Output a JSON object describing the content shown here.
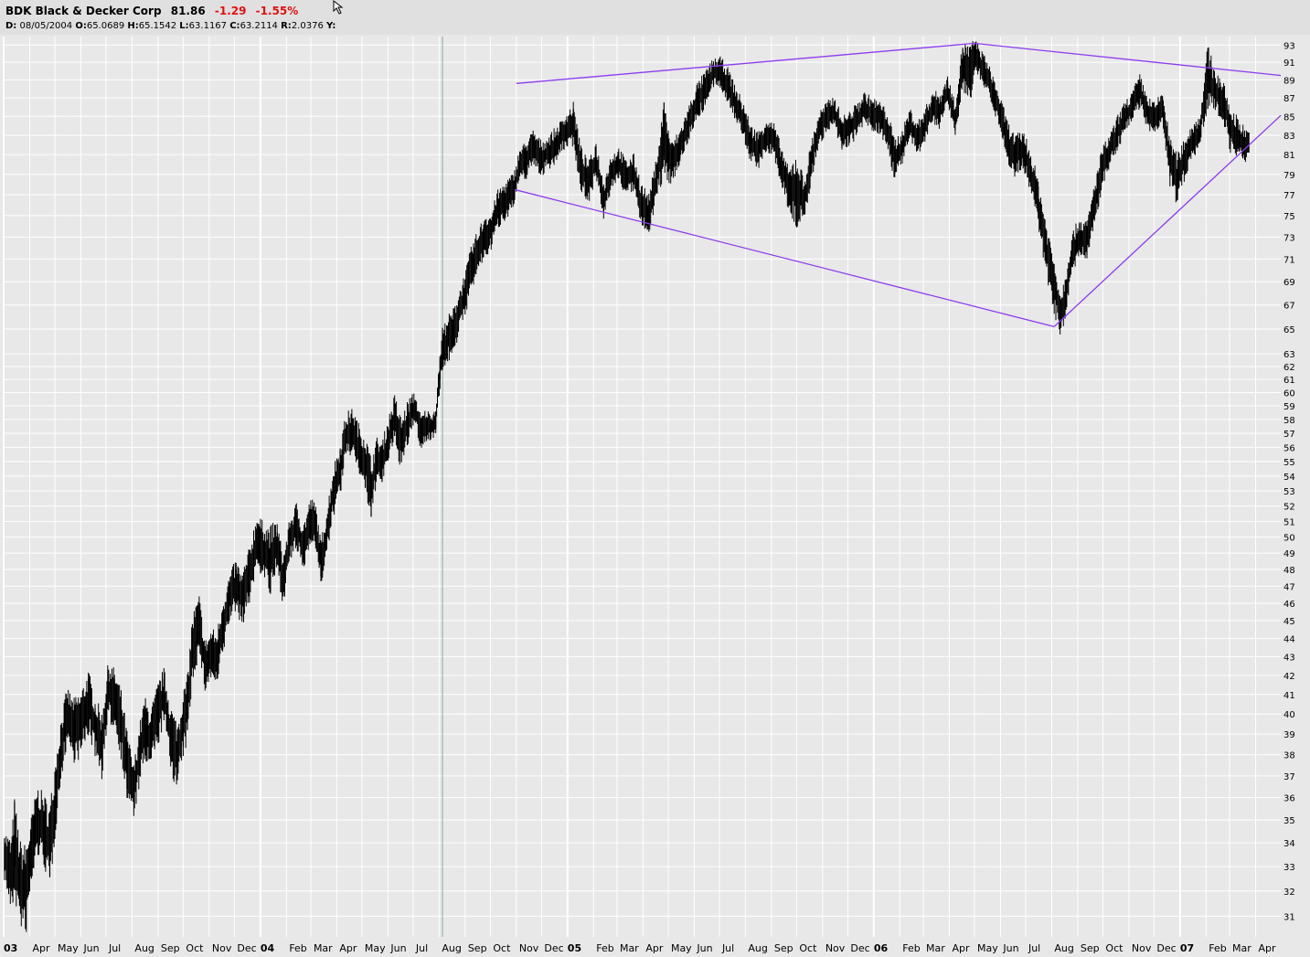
{
  "header": {
    "symbol": "BDK",
    "name": "Black & Decker Corp",
    "last": "81.86",
    "change": "-1.29",
    "change_pct": "-1.55%",
    "ohlc": {
      "date_label": "D:",
      "date": "08/05/2004",
      "open_label": "O:",
      "open": "65.0689",
      "high_label": "H:",
      "high": "65.1542",
      "low_label": "L:",
      "low": "63.1167",
      "close_label": "C:",
      "close": "63.2114",
      "range_label": "R:",
      "range": "2.0376",
      "y_label": "Y:"
    }
  },
  "colors": {
    "background": "#e8e8e8",
    "grid": "#ffffff",
    "price": "#000000",
    "trendline": "#8c3cf0",
    "crosshair": "#88aaaa",
    "negative": "#e01010"
  },
  "chart_data": {
    "type": "line",
    "style": "ohlc-bars",
    "scale": "log",
    "grid": true,
    "xlim": [
      "2003-03-01",
      "2007-05-01"
    ],
    "ylim": [
      30.2,
      94
    ],
    "x_ticks": [
      {
        "date": "2003-03-01",
        "label": "03",
        "bold": true
      },
      {
        "date": "2003-04-01",
        "label": "Apr"
      },
      {
        "date": "2003-05-01",
        "label": "May"
      },
      {
        "date": "2003-06-01",
        "label": "Jun"
      },
      {
        "date": "2003-07-01",
        "label": "Jul"
      },
      {
        "date": "2003-08-01",
        "label": "Aug"
      },
      {
        "date": "2003-09-01",
        "label": "Sep"
      },
      {
        "date": "2003-10-01",
        "label": "Oct"
      },
      {
        "date": "2003-11-01",
        "label": "Nov"
      },
      {
        "date": "2003-12-01",
        "label": "Dec"
      },
      {
        "date": "2004-01-01",
        "label": "04",
        "bold": true
      },
      {
        "date": "2004-02-01",
        "label": "Feb"
      },
      {
        "date": "2004-03-01",
        "label": "Mar"
      },
      {
        "date": "2004-04-01",
        "label": "Apr"
      },
      {
        "date": "2004-05-01",
        "label": "May"
      },
      {
        "date": "2004-06-01",
        "label": "Jun"
      },
      {
        "date": "2004-07-01",
        "label": "Jul"
      },
      {
        "date": "2004-08-01",
        "label": "Aug"
      },
      {
        "date": "2004-09-01",
        "label": "Sep"
      },
      {
        "date": "2004-10-01",
        "label": "Oct"
      },
      {
        "date": "2004-11-01",
        "label": "Nov"
      },
      {
        "date": "2004-12-01",
        "label": "Dec"
      },
      {
        "date": "2005-01-01",
        "label": "05",
        "bold": true
      },
      {
        "date": "2005-02-01",
        "label": "Feb"
      },
      {
        "date": "2005-03-01",
        "label": "Mar"
      },
      {
        "date": "2005-04-01",
        "label": "Apr"
      },
      {
        "date": "2005-05-01",
        "label": "May"
      },
      {
        "date": "2005-06-01",
        "label": "Jun"
      },
      {
        "date": "2005-07-01",
        "label": "Jul"
      },
      {
        "date": "2005-08-01",
        "label": "Aug"
      },
      {
        "date": "2005-09-01",
        "label": "Sep"
      },
      {
        "date": "2005-10-01",
        "label": "Oct"
      },
      {
        "date": "2005-11-01",
        "label": "Nov"
      },
      {
        "date": "2005-12-01",
        "label": "Dec"
      },
      {
        "date": "2006-01-01",
        "label": "06",
        "bold": true
      },
      {
        "date": "2006-02-01",
        "label": "Feb"
      },
      {
        "date": "2006-03-01",
        "label": "Mar"
      },
      {
        "date": "2006-04-01",
        "label": "Apr"
      },
      {
        "date": "2006-05-01",
        "label": "May"
      },
      {
        "date": "2006-06-01",
        "label": "Jun"
      },
      {
        "date": "2006-07-01",
        "label": "Jul"
      },
      {
        "date": "2006-08-01",
        "label": "Aug"
      },
      {
        "date": "2006-09-01",
        "label": "Sep"
      },
      {
        "date": "2006-10-01",
        "label": "Oct"
      },
      {
        "date": "2006-11-01",
        "label": "Nov"
      },
      {
        "date": "2006-12-01",
        "label": "Dec"
      },
      {
        "date": "2007-01-01",
        "label": "07",
        "bold": true
      },
      {
        "date": "2007-02-01",
        "label": "Feb"
      },
      {
        "date": "2007-03-01",
        "label": "Mar"
      },
      {
        "date": "2007-04-01",
        "label": "Apr"
      }
    ],
    "y_ticks": [
      31,
      32,
      33,
      34,
      35,
      36,
      37,
      38,
      39,
      40,
      41,
      42,
      43,
      44,
      45,
      46,
      47,
      48,
      49,
      50,
      51,
      52,
      53,
      54,
      55,
      56,
      57,
      58,
      59,
      60,
      61,
      62,
      63,
      65,
      67,
      69,
      71,
      73,
      75,
      77,
      79,
      81,
      83,
      85,
      87,
      89,
      91,
      93
    ],
    "series": [
      {
        "style": "ohlc",
        "x": [
          "2003-03-02",
          "2003-03-10",
          "2003-03-14",
          "2003-03-20",
          "2003-03-27",
          "2003-04-03",
          "2003-04-10",
          "2003-04-18",
          "2003-04-25",
          "2003-05-02",
          "2003-05-09",
          "2003-05-16",
          "2003-05-23",
          "2003-06-01",
          "2003-06-10",
          "2003-06-18",
          "2003-06-26",
          "2003-07-04",
          "2003-07-11",
          "2003-07-18",
          "2003-07-26",
          "2003-08-03",
          "2003-08-10",
          "2003-08-16",
          "2003-08-23",
          "2003-09-01",
          "2003-09-08",
          "2003-09-16",
          "2003-09-24",
          "2003-10-01",
          "2003-10-06",
          "2003-10-12",
          "2003-10-20",
          "2003-10-27",
          "2003-11-04",
          "2003-11-10",
          "2003-11-17",
          "2003-11-25",
          "2003-12-03",
          "2003-12-10",
          "2003-12-18",
          "2003-12-28",
          "2004-01-06",
          "2004-01-13",
          "2004-01-21",
          "2004-01-28",
          "2004-02-05",
          "2004-02-13",
          "2004-02-21",
          "2004-03-01",
          "2004-03-07",
          "2004-03-13",
          "2004-03-20",
          "2004-03-28",
          "2004-04-05",
          "2004-04-12",
          "2004-04-20",
          "2004-04-28",
          "2004-05-05",
          "2004-05-12",
          "2004-05-19",
          "2004-05-25",
          "2004-06-01",
          "2004-06-09",
          "2004-06-17",
          "2004-06-25",
          "2004-07-03",
          "2004-07-10",
          "2004-07-17",
          "2004-07-22",
          "2004-07-28",
          "2004-08-02",
          "2004-08-05",
          "2004-08-10",
          "2004-08-17",
          "2004-08-24",
          "2004-09-01",
          "2004-09-09",
          "2004-09-17",
          "2004-09-25",
          "2004-10-02",
          "2004-10-09",
          "2004-10-16",
          "2004-10-22",
          "2004-10-29",
          "2004-11-05",
          "2004-11-13",
          "2004-11-21",
          "2004-12-01",
          "2004-12-10",
          "2004-12-20",
          "2004-12-30",
          "2005-01-08",
          "2005-01-17",
          "2005-01-26",
          "2005-02-04",
          "2005-02-13",
          "2005-02-22",
          "2005-03-03",
          "2005-03-12",
          "2005-03-21",
          "2005-03-30",
          "2005-04-08",
          "2005-04-17",
          "2005-04-26",
          "2005-05-05",
          "2005-05-15",
          "2005-05-25",
          "2005-06-04",
          "2005-06-14",
          "2005-06-24",
          "2005-07-03",
          "2005-07-12",
          "2005-07-21",
          "2005-07-30",
          "2005-08-08",
          "2005-08-17",
          "2005-08-26",
          "2005-09-04",
          "2005-09-13",
          "2005-09-22",
          "2005-10-01",
          "2005-10-10",
          "2005-10-19",
          "2005-10-28",
          "2005-11-06",
          "2005-11-15",
          "2005-11-24",
          "2005-12-03",
          "2005-12-12",
          "2005-12-21",
          "2005-12-30",
          "2006-01-08",
          "2006-01-17",
          "2006-01-26",
          "2006-02-04",
          "2006-02-13",
          "2006-02-22",
          "2006-03-03",
          "2006-03-12",
          "2006-03-21",
          "2006-03-30",
          "2006-04-08",
          "2006-04-17",
          "2006-04-26",
          "2006-05-02",
          "2006-05-06",
          "2006-05-14",
          "2006-05-23",
          "2006-06-01",
          "2006-06-10",
          "2006-06-19",
          "2006-06-28",
          "2006-07-07",
          "2006-07-16",
          "2006-07-25",
          "2006-08-03",
          "2006-08-12",
          "2006-08-18",
          "2006-08-25",
          "2006-09-03",
          "2006-09-12",
          "2006-09-21",
          "2006-09-30",
          "2006-10-09",
          "2006-10-18",
          "2006-10-27",
          "2006-11-05",
          "2006-11-14",
          "2006-11-23",
          "2006-12-02",
          "2006-12-11",
          "2006-12-20",
          "2006-12-29",
          "2007-01-07",
          "2007-01-16",
          "2007-01-25",
          "2007-02-03",
          "2007-02-12",
          "2007-02-21",
          "2007-03-02",
          "2007-03-10",
          "2007-03-17",
          "2007-03-24"
        ],
        "close": [
          33.5,
          32.6,
          33.8,
          32.4,
          32.0,
          33.6,
          35.0,
          34.6,
          33.8,
          36.2,
          38.5,
          40.0,
          39.2,
          39.5,
          40.6,
          39.4,
          38.5,
          41.2,
          40.8,
          39.8,
          37.5,
          36.3,
          38.0,
          39.2,
          38.8,
          40.0,
          41.0,
          38.9,
          37.9,
          39.5,
          40.3,
          43.5,
          44.8,
          42.5,
          43.2,
          42.8,
          44.6,
          46.3,
          47.1,
          46.2,
          47.5,
          49.8,
          49.1,
          48.5,
          49.5,
          47.3,
          49.8,
          50.7,
          49.3,
          51.2,
          50.6,
          48.4,
          50.2,
          53.0,
          54.5,
          56.8,
          57.2,
          55.8,
          55.0,
          53.0,
          55.3,
          54.8,
          56.5,
          58.0,
          56.2,
          57.8,
          59.0,
          57.0,
          57.6,
          57.4,
          58.0,
          61.7,
          63.2,
          64.0,
          64.8,
          66.2,
          68.0,
          70.3,
          71.8,
          73.2,
          73.5,
          75.5,
          76.2,
          76.8,
          77.5,
          80.0,
          80.5,
          81.8,
          80.6,
          81.3,
          82.2,
          83.5,
          84.2,
          79.6,
          78.2,
          80.5,
          76.3,
          79.3,
          80.1,
          78.6,
          79.2,
          76.0,
          75.2,
          78.6,
          82.5,
          80.2,
          81.8,
          84.2,
          86.6,
          87.9,
          89.8,
          89.7,
          88.3,
          86.2,
          84.5,
          82.0,
          81.6,
          83.0,
          82.5,
          79.8,
          77.4,
          77.6,
          76.4,
          80.5,
          83.8,
          84.9,
          85.5,
          83.0,
          83.8,
          84.5,
          86.0,
          85.2,
          84.9,
          83.6,
          80.5,
          81.8,
          84.2,
          82.6,
          84.0,
          86.1,
          85.6,
          87.9,
          84.6,
          90.7,
          89.4,
          92.2,
          91.2,
          89.8,
          87.8,
          85.1,
          82.2,
          80.8,
          81.6,
          79.2,
          76.2,
          72.2,
          69.0,
          66.2,
          68.0,
          71.5,
          73.0,
          72.6,
          76.0,
          79.6,
          81.3,
          83.2,
          84.8,
          86.0,
          87.8,
          85.4,
          84.6,
          86.1,
          80.2,
          78.5,
          80.8,
          82.4,
          83.6,
          89.5,
          87.6,
          86.8,
          83.6,
          83.0,
          82.0,
          81.86
        ],
        "high": [
          34.2,
          34.0,
          35.8,
          33.6,
          33.0,
          34.5,
          36.0,
          35.4,
          35.0,
          37.4,
          39.4,
          40.8,
          40.2,
          40.6,
          41.8,
          40.3,
          39.6,
          42.3,
          41.8,
          40.8,
          38.6,
          37.4,
          38.9,
          40.4,
          39.6,
          41.0,
          41.8,
          39.9,
          39.0,
          40.6,
          41.4,
          44.8,
          45.8,
          43.4,
          44.0,
          43.8,
          45.6,
          47.0,
          48.0,
          47.2,
          48.6,
          50.9,
          50.2,
          49.6,
          50.3,
          48.4,
          50.6,
          51.6,
          50.4,
          52.0,
          51.5,
          49.4,
          51.2,
          54.0,
          55.8,
          57.8,
          58.1,
          56.9,
          55.8,
          54.2,
          56.2,
          55.7,
          57.4,
          59.2,
          57.4,
          58.8,
          59.3,
          58.0,
          58.2,
          58.0,
          58.6,
          62.8,
          65.1,
          65.3,
          65.8,
          67.4,
          69.2,
          71.6,
          72.9,
          74.6,
          74.5,
          76.6,
          77.4,
          78.0,
          78.4,
          81.0,
          81.8,
          82.9,
          81.8,
          82.4,
          83.4,
          84.6,
          85.8,
          81.3,
          79.8,
          81.8,
          78.0,
          80.2,
          81.2,
          79.8,
          80.4,
          77.8,
          76.5,
          80.0,
          86.5,
          81.6,
          83.0,
          85.3,
          87.9,
          89.2,
          90.6,
          90.9,
          89.5,
          87.4,
          85.8,
          83.4,
          82.8,
          84.2,
          83.6,
          81.2,
          78.8,
          78.8,
          77.8,
          81.9,
          84.9,
          86.0,
          86.6,
          84.3,
          84.9,
          85.8,
          87.0,
          86.4,
          86.0,
          84.9,
          81.9,
          82.9,
          85.3,
          83.8,
          85.2,
          87.2,
          86.9,
          88.8,
          85.8,
          92.5,
          92.8,
          93.2,
          92.3,
          91.0,
          88.9,
          86.4,
          83.6,
          82.2,
          82.9,
          80.6,
          77.8,
          73.8,
          70.6,
          67.5,
          69.2,
          72.7,
          74.2,
          73.8,
          77.4,
          81.0,
          82.4,
          84.2,
          85.9,
          87.1,
          89.0,
          86.6,
          85.8,
          87.2,
          82.0,
          79.8,
          82.2,
          83.6,
          84.6,
          90.4,
          89.2,
          88.2,
          85.1,
          84.4,
          83.4,
          83.3
        ],
        "low": [
          32.8,
          32.0,
          33.0,
          31.4,
          30.5,
          32.5,
          34.0,
          33.4,
          32.6,
          35.2,
          37.4,
          39.0,
          38.2,
          38.4,
          39.6,
          38.4,
          37.5,
          40.2,
          39.8,
          38.6,
          36.4,
          35.8,
          37.0,
          38.2,
          37.8,
          38.9,
          40.0,
          37.8,
          36.8,
          38.4,
          39.2,
          42.4,
          43.6,
          41.6,
          42.2,
          41.8,
          43.4,
          45.2,
          46.0,
          45.2,
          46.4,
          48.6,
          48.0,
          46.7,
          48.3,
          46.4,
          48.8,
          49.6,
          48.4,
          50.2,
          49.5,
          47.6,
          49.2,
          51.8,
          53.4,
          55.6,
          56.0,
          54.6,
          53.2,
          51.3,
          54.4,
          53.6,
          55.4,
          56.8,
          55.0,
          56.6,
          57.9,
          56.3,
          56.6,
          56.7,
          57.3,
          61.0,
          63.1,
          62.6,
          63.6,
          64.8,
          66.8,
          68.9,
          70.4,
          71.8,
          72.3,
          74.2,
          75.0,
          75.6,
          76.2,
          78.8,
          79.3,
          80.6,
          79.4,
          80.1,
          81.0,
          82.3,
          82.8,
          78.3,
          77.2,
          79.3,
          75.4,
          77.9,
          79.0,
          77.4,
          78.0,
          74.9,
          74.1,
          77.3,
          81.0,
          78.9,
          80.6,
          82.9,
          85.3,
          86.5,
          88.4,
          88.4,
          87.0,
          84.9,
          83.2,
          80.8,
          80.3,
          81.8,
          81.3,
          78.5,
          76.1,
          73.9,
          75.1,
          79.1,
          82.6,
          83.8,
          84.3,
          81.7,
          82.6,
          83.3,
          84.8,
          84.0,
          83.7,
          82.3,
          79.1,
          80.6,
          83.0,
          81.4,
          82.8,
          84.9,
          84.4,
          86.7,
          83.5,
          88.8,
          88.1,
          90.9,
          90.0,
          88.6,
          86.6,
          83.8,
          80.8,
          79.4,
          80.2,
          77.8,
          74.7,
          70.6,
          67.4,
          65.1,
          66.6,
          70.3,
          71.8,
          71.4,
          74.6,
          78.2,
          80.2,
          81.9,
          83.6,
          84.8,
          86.6,
          84.2,
          83.4,
          84.9,
          78.8,
          76.5,
          79.4,
          81.2,
          82.4,
          85.8,
          86.0,
          85.4,
          82.0,
          81.7,
          80.6,
          81.2
        ]
      }
    ],
    "trendlines": [
      {
        "from": {
          "x": "2004-11-01",
          "y": 88.6
        },
        "to": {
          "x": "2006-05-01",
          "y": 93.2
        }
      },
      {
        "from": {
          "x": "2006-05-01",
          "y": 93.2
        },
        "to": {
          "x": "2007-05-01",
          "y": 89.5
        }
      },
      {
        "from": {
          "x": "2004-10-30",
          "y": 77.5
        },
        "to": {
          "x": "2006-08-04",
          "y": 65.2
        }
      },
      {
        "from": {
          "x": "2006-08-04",
          "y": 65.2
        },
        "to": {
          "x": "2007-05-01",
          "y": 85.1
        }
      }
    ],
    "crosshair_date": "2004-08-05"
  }
}
